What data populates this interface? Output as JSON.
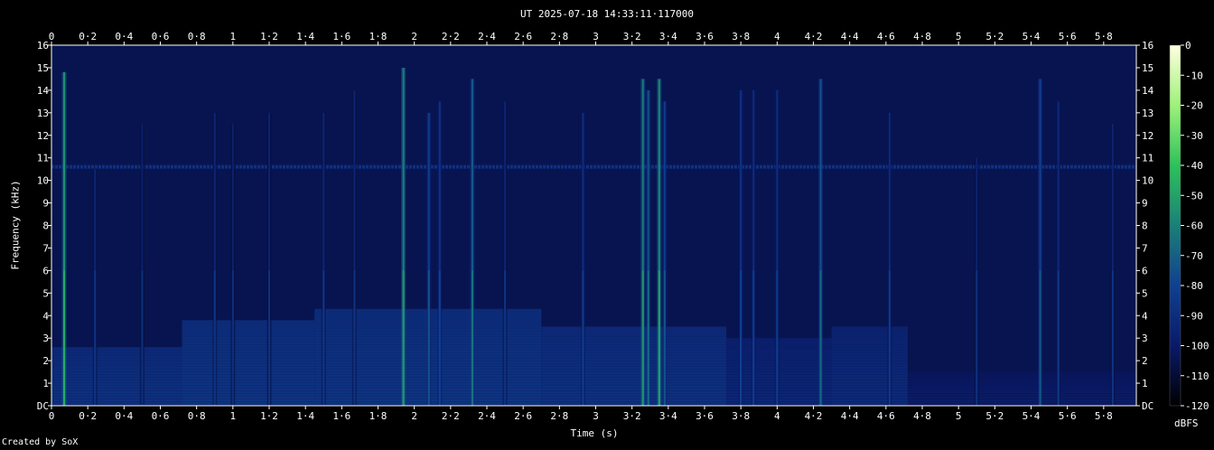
{
  "title": "UT 2025-07-18 14:33:11·117000",
  "credit": "Created by SoX",
  "chart_data": {
    "type": "heatmap",
    "title": "UT 2025-07-18 14:33:11·117000",
    "xlabel": "Time (s)",
    "ylabel": "Frequency (kHz)",
    "xlim": [
      0,
      5.98
    ],
    "ylim": [
      0,
      16
    ],
    "x_ticks": [
      "0",
      "0·2",
      "0·4",
      "0·6",
      "0·8",
      "1",
      "1·2",
      "1·4",
      "1·6",
      "1·8",
      "2",
      "2·2",
      "2·4",
      "2·6",
      "2·8",
      "3",
      "3·2",
      "3·4",
      "3·6",
      "3·8",
      "4",
      "4·2",
      "4·4",
      "4·6",
      "4·8",
      "5",
      "5·2",
      "5·4",
      "5·6",
      "5·8"
    ],
    "y_ticks": [
      "DC",
      "1",
      "2",
      "3",
      "4",
      "5",
      "6",
      "7",
      "8",
      "9",
      "10",
      "11",
      "12",
      "13",
      "14",
      "15",
      "16"
    ],
    "colorbar": {
      "unit": "dBFS",
      "range": [
        -120,
        0
      ],
      "ticks": [
        "0",
        "-10",
        "-20",
        "-30",
        "-40",
        "-50",
        "-60",
        "-70",
        "-80",
        "-90",
        "-100",
        "-110",
        "-120"
      ],
      "colors": [
        "#000000",
        "#0a1a6a",
        "#104090",
        "#1a8078",
        "#2ec25a",
        "#9ef27a",
        "#ffffe0"
      ]
    },
    "background_level_dbfs": -105,
    "hum_lines": [
      {
        "freq_khz": 10.6,
        "level_dbfs": -88
      }
    ],
    "transients": [
      {
        "t": 0.07,
        "f_max_khz": 14.8,
        "level_dbfs": -55
      },
      {
        "t": 0.24,
        "f_max_khz": 10.5,
        "level_dbfs": -95
      },
      {
        "t": 0.5,
        "f_max_khz": 12.5,
        "level_dbfs": -97
      },
      {
        "t": 0.9,
        "f_max_khz": 13.0,
        "level_dbfs": -95
      },
      {
        "t": 1.0,
        "f_max_khz": 12.5,
        "level_dbfs": -97
      },
      {
        "t": 1.2,
        "f_max_khz": 13.0,
        "level_dbfs": -96
      },
      {
        "t": 1.5,
        "f_max_khz": 13.0,
        "level_dbfs": -94
      },
      {
        "t": 1.67,
        "f_max_khz": 14.0,
        "level_dbfs": -95
      },
      {
        "t": 1.94,
        "f_max_khz": 15.0,
        "level_dbfs": -60
      },
      {
        "t": 2.08,
        "f_max_khz": 13.0,
        "level_dbfs": -82
      },
      {
        "t": 2.14,
        "f_max_khz": 13.5,
        "level_dbfs": -88
      },
      {
        "t": 2.32,
        "f_max_khz": 14.5,
        "level_dbfs": -72
      },
      {
        "t": 2.5,
        "f_max_khz": 13.5,
        "level_dbfs": -95
      },
      {
        "t": 2.93,
        "f_max_khz": 13.0,
        "level_dbfs": -90
      },
      {
        "t": 3.26,
        "f_max_khz": 14.5,
        "level_dbfs": -62
      },
      {
        "t": 3.29,
        "f_max_khz": 14.0,
        "level_dbfs": -75
      },
      {
        "t": 3.35,
        "f_max_khz": 14.5,
        "level_dbfs": -58
      },
      {
        "t": 3.38,
        "f_max_khz": 13.5,
        "level_dbfs": -82
      },
      {
        "t": 3.8,
        "f_max_khz": 14.0,
        "level_dbfs": -88
      },
      {
        "t": 3.87,
        "f_max_khz": 14.0,
        "level_dbfs": -90
      },
      {
        "t": 4.0,
        "f_max_khz": 14.0,
        "level_dbfs": -90
      },
      {
        "t": 4.24,
        "f_max_khz": 14.5,
        "level_dbfs": -75
      },
      {
        "t": 4.62,
        "f_max_khz": 13.0,
        "level_dbfs": -92
      },
      {
        "t": 5.1,
        "f_max_khz": 11.0,
        "level_dbfs": -96
      },
      {
        "t": 5.45,
        "f_max_khz": 14.5,
        "level_dbfs": -80
      },
      {
        "t": 5.55,
        "f_max_khz": 13.5,
        "level_dbfs": -92
      },
      {
        "t": 5.85,
        "f_max_khz": 12.5,
        "level_dbfs": -95
      }
    ],
    "harmonic_blocks": [
      {
        "t_start": 0.0,
        "t_end": 0.72,
        "f_max_khz": 2.6,
        "level_dbfs": -80
      },
      {
        "t_start": 0.72,
        "t_end": 1.45,
        "f_max_khz": 3.8,
        "level_dbfs": -78
      },
      {
        "t_start": 1.45,
        "t_end": 2.7,
        "f_max_khz": 4.3,
        "level_dbfs": -78
      },
      {
        "t_start": 2.7,
        "t_end": 3.72,
        "f_max_khz": 3.5,
        "level_dbfs": -80
      },
      {
        "t_start": 3.72,
        "t_end": 4.3,
        "f_max_khz": 3.0,
        "level_dbfs": -86
      },
      {
        "t_start": 4.3,
        "t_end": 4.72,
        "f_max_khz": 3.5,
        "level_dbfs": -84
      },
      {
        "t_start": 4.72,
        "t_end": 5.98,
        "f_max_khz": 1.5,
        "level_dbfs": -92
      }
    ]
  }
}
